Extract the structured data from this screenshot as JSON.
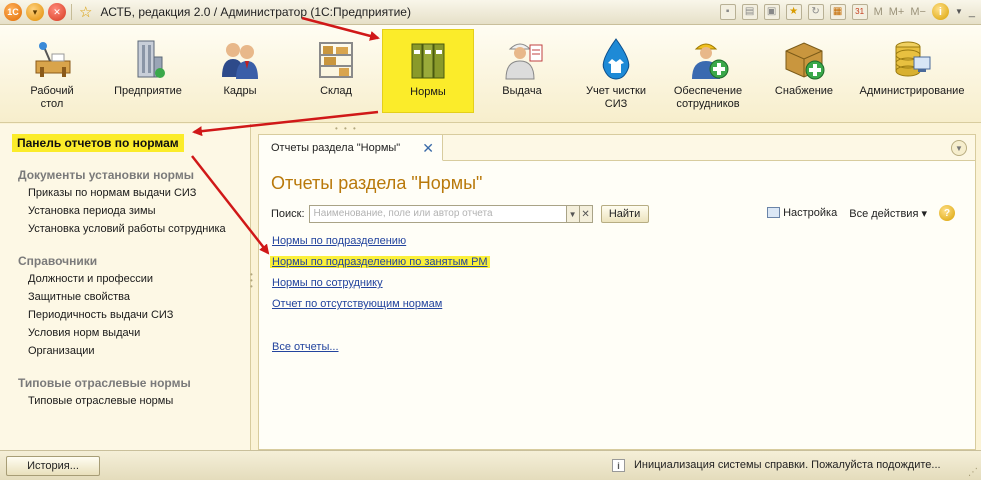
{
  "window": {
    "title": "АСТБ, редакция 2.0 / Администратор  (1С:Предприятие)"
  },
  "toolbar_right": {
    "m_label": "M",
    "mplus_label": "M+",
    "mminus_label": "M−",
    "info_glyph": "i"
  },
  "sections": [
    {
      "label": "Рабочий стол",
      "icon": "desk-icon"
    },
    {
      "label": "Предприятие",
      "icon": "building-icon"
    },
    {
      "label": "Кадры",
      "icon": "people-icon"
    },
    {
      "label": "Склад",
      "icon": "warehouse-icon"
    },
    {
      "label": "Нормы",
      "icon": "binders-icon",
      "active": true
    },
    {
      "label": "Выдача",
      "icon": "worker-icon"
    },
    {
      "label": "Учет чистки СИЗ",
      "icon": "water-drop-icon"
    },
    {
      "label": "Обеспечение сотрудников",
      "icon": "worker-add-icon"
    },
    {
      "label": "Снабжение",
      "icon": "box-add-icon"
    },
    {
      "label": "Администрирование",
      "icon": "database-icon"
    }
  ],
  "left_panel": {
    "title": "Панель отчетов по нормам",
    "groups": [
      {
        "title": "Документы установки нормы",
        "items": [
          "Приказы по нормам выдачи СИЗ",
          "Установка периода зимы",
          "Установка условий работы сотрудника"
        ]
      },
      {
        "title": "Справочники",
        "items": [
          "Должности и профессии",
          "Защитные свойства",
          "Периодичность выдачи СИЗ",
          "Условия норм выдачи",
          "Организации"
        ]
      },
      {
        "title": "Типовые отраслевые нормы",
        "items": [
          "Типовые отраслевые нормы"
        ]
      }
    ]
  },
  "main": {
    "tab_label": "Отчеты раздела \"Нормы\"",
    "tab_close": "✕",
    "title": "Отчеты раздела \"Нормы\"",
    "search_label": "Поиск:",
    "search_placeholder": "Наименование, поле или автор отчета",
    "find_button": "Найти",
    "settings_label": "Настройка",
    "all_actions_label": "Все действия ▾",
    "help_glyph": "?",
    "reports": [
      "Нормы по подразделению",
      "Нормы по подразделению по занятым РМ",
      "Нормы по сотруднику",
      "Отчет по отсутствующим нормам"
    ],
    "all_reports_link": "Все отчеты..."
  },
  "statusbar": {
    "history_button": "История...",
    "message": "Инициализация системы справки. Пожалуйста подождите..."
  },
  "colors": {
    "highlight": "#fbec2a",
    "arrow": "#d01818",
    "link": "#23449e",
    "title_orange": "#b9790b"
  }
}
